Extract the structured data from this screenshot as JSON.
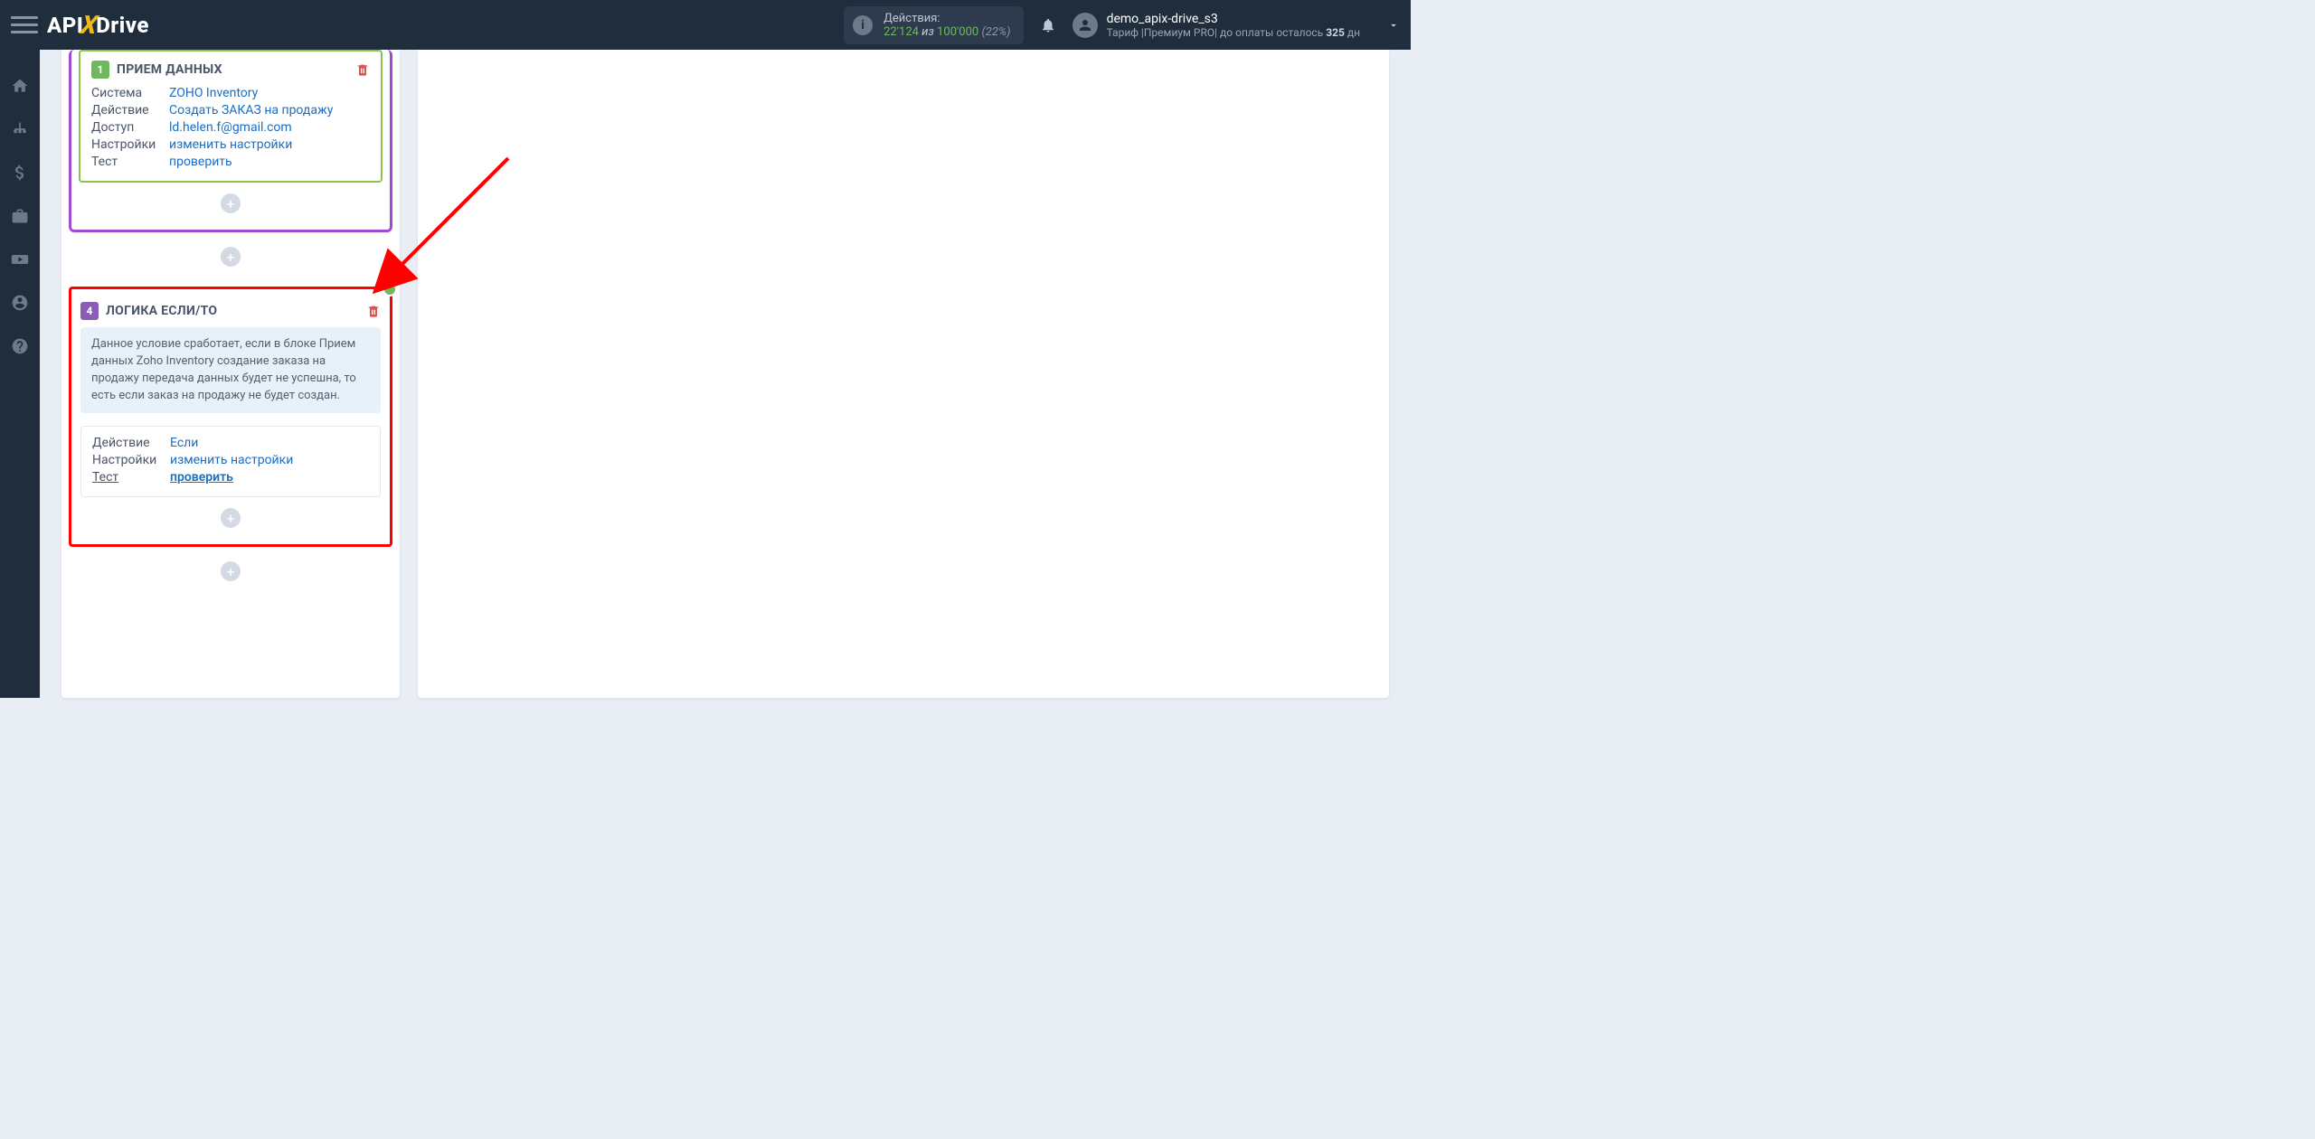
{
  "header": {
    "logo_api": "API",
    "logo_drive": "Drive",
    "actions_label": "Действия:",
    "actions_used": "22'124",
    "actions_of": "из",
    "actions_total": "100'000",
    "actions_pct": "(22%)",
    "user_name": "demo_apix-drive_s3",
    "plan_prefix": "Тариф |",
    "plan_name": "Премиум PRO",
    "plan_mid": "| до оплаты осталось ",
    "plan_days": "325",
    "plan_suffix": " дн"
  },
  "card1": {
    "num": "1",
    "title": "ПРИЕМ ДАННЫХ",
    "rows": {
      "system_lbl": "Система",
      "system_val": "ZOHO Inventory",
      "action_lbl": "Действие",
      "action_val": "Создать ЗАКАЗ на продажу",
      "access_lbl": "Доступ",
      "access_val": "ld.helen.f@gmail.com",
      "settings_lbl": "Настройки",
      "settings_val": "изменить настройки",
      "test_lbl": "Тест",
      "test_val": "проверить"
    }
  },
  "card4": {
    "num": "4",
    "title": "ЛОГИКА ЕСЛИ/ТО",
    "desc": "Данное условие сработает, если в блоке Прием данных Zoho Inventory создание заказа на продажу передача данных будет не успешна, то есть если заказ на продажу не будет создан.",
    "rows": {
      "action_lbl": "Действие",
      "action_val": "Если",
      "settings_lbl": "Настройки",
      "settings_val": "изменить настройки",
      "test_lbl": "Тест",
      "test_val": "проверить"
    }
  }
}
